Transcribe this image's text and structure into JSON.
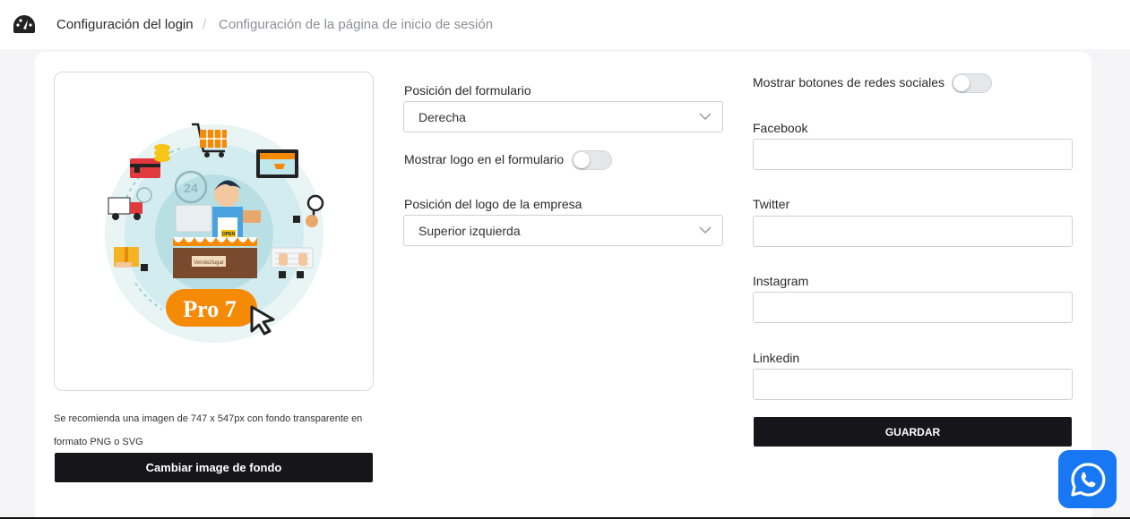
{
  "breadcrumb": {
    "current": "Configuración del login",
    "separator": "/",
    "sub": "Configuración de la página de inicio de sesión"
  },
  "image_panel": {
    "badge_text": "Pro 7",
    "shop_sign": "Vende2lugar",
    "open_sign": "OPEN",
    "hint": "Se recomienda una imagen de 747 x 547px con fondo transparente en formato PNG o SVG",
    "change_button": "Cambiar image de fondo"
  },
  "form": {
    "position_label": "Posición del formulario",
    "position_value": "Derecha",
    "show_logo_label": "Mostrar logo en el formulario",
    "show_logo_enabled": false,
    "logo_position_label": "Posición del logo de la empresa",
    "logo_position_value": "Superior izquierda"
  },
  "social": {
    "toggle_label": "Mostrar botones de redes sociales",
    "toggle_enabled": false,
    "facebook_label": "Facebook",
    "facebook_value": "",
    "twitter_label": "Twitter",
    "twitter_value": "",
    "instagram_label": "Instagram",
    "instagram_value": "",
    "linkedin_label": "Linkedin",
    "linkedin_value": "",
    "save_button": "GUARDAR"
  },
  "colors": {
    "primary_dark": "#16161a",
    "accent_orange": "#f58a07",
    "whatsapp_blue": "#1877f2"
  },
  "icons": {
    "header": "dashboard-gauge-icon",
    "select_chevron": "chevron-down-icon",
    "floating": "whatsapp-icon"
  }
}
